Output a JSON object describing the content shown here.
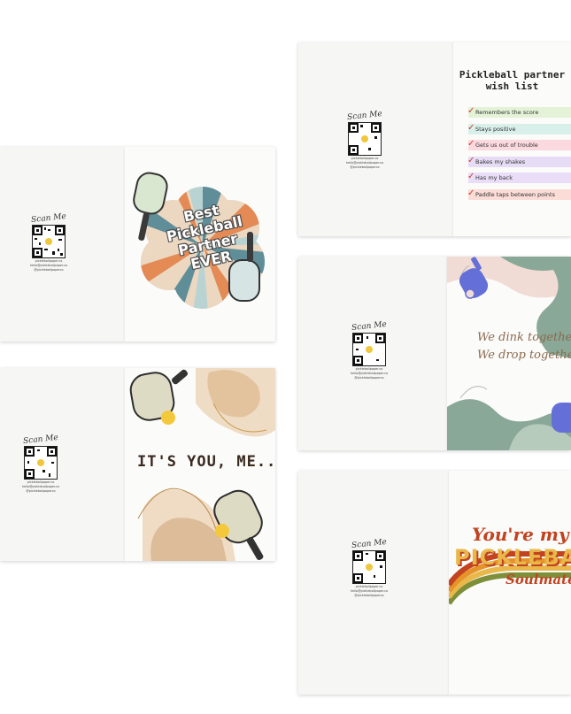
{
  "qr": {
    "scan_label": "Scan Me",
    "info_lines": [
      "pickleballpaper.co",
      "hello@pickleballpaper.co",
      "@pickleballpaperco"
    ]
  },
  "card_best": {
    "title_lines": [
      "Best",
      "Pickleball",
      "Partner",
      "EVER"
    ]
  },
  "card_itsyou": {
    "title": "IT'S YOU, ME..."
  },
  "card_wishlist": {
    "title_lines": [
      "Pickleball partner",
      "wish list"
    ],
    "items": [
      {
        "label": "Remembers the score",
        "color": "#e4f3d7"
      },
      {
        "label": "Stays positive",
        "color": "#d9f0ea"
      },
      {
        "label": "Gets us out of trouble",
        "color": "#fbd9de"
      },
      {
        "label": "Bakes my shakes",
        "color": "#e6dcf6"
      },
      {
        "label": "Has my back",
        "color": "#e9ddf7"
      },
      {
        "label": "Paddle taps between points",
        "color": "#fbdcd6"
      }
    ]
  },
  "card_dink": {
    "lines": [
      "We dink together",
      "We drop together"
    ]
  },
  "card_soulmate": {
    "lines": [
      "You're my",
      "PICKLEBALL",
      "Soulmate"
    ]
  },
  "colors": {
    "sage": "#8aa897",
    "blush": "#f0d9d2",
    "periwinkle": "#6470d8",
    "sand": "#e7c9a5",
    "teal_ray": "#5f8e99",
    "orange_ray": "#e38a55",
    "retro_red": "#c2431f",
    "retro_orange": "#e6932a",
    "retro_yellow": "#e9b84a",
    "retro_green": "#7e8f3a"
  }
}
